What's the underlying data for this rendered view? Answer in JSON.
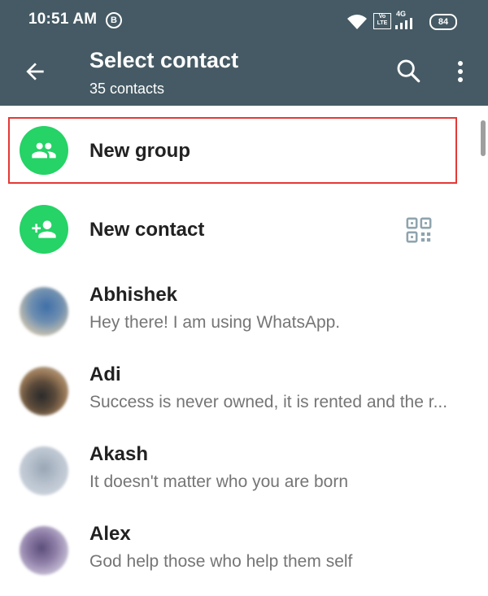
{
  "status_bar": {
    "time": "10:51 AM",
    "notification_badge": "B",
    "network": "4G",
    "volte": "Vo LTE",
    "battery": "84"
  },
  "toolbar": {
    "title": "Select contact",
    "subtitle": "35 contacts",
    "back_icon": "arrow-back-icon",
    "search_icon": "search-icon",
    "more_icon": "more-vert-icon"
  },
  "actions": {
    "new_group": {
      "label": "New group",
      "icon": "group-icon",
      "highlighted": true
    },
    "new_contact": {
      "label": "New contact",
      "icon": "person-add-icon",
      "trailing_icon": "qr-code-icon"
    }
  },
  "contacts": [
    {
      "name": "Abhishek",
      "status": "Hey there! I am using WhatsApp."
    },
    {
      "name": "Adi",
      "status": "Success is never owned, it is rented and the r..."
    },
    {
      "name": "Akash",
      "status": "It doesn't matter who you are born"
    },
    {
      "name": "Alex",
      "status": "God help those who help them self"
    }
  ],
  "colors": {
    "header": "#455a64",
    "accent_green": "#25d366",
    "highlight_border": "#e53935",
    "secondary_text": "#757575"
  }
}
